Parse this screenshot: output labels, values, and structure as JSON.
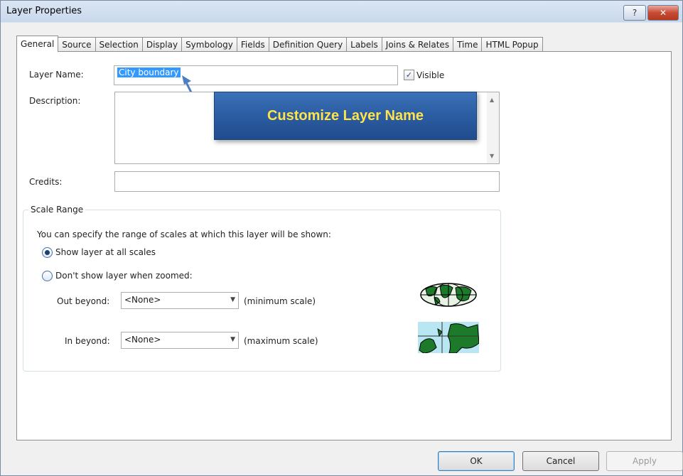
{
  "window": {
    "title": "Layer Properties",
    "help_label": "?",
    "close_label": "✕"
  },
  "tabs": [
    "General",
    "Source",
    "Selection",
    "Display",
    "Symbology",
    "Fields",
    "Definition Query",
    "Labels",
    "Joins & Relates",
    "Time",
    "HTML Popup"
  ],
  "general": {
    "layer_name_label": "Layer Name:",
    "layer_name_value": "City boundary",
    "visible_label": "Visible",
    "visible_checked": true,
    "description_label": "Description:",
    "description_value": "",
    "credits_label": "Credits:",
    "credits_value": ""
  },
  "callout": {
    "text": "Customize Layer Name",
    "text_color": "#ffe34a",
    "bg_color": "#2a5aa0"
  },
  "scale_range": {
    "title": "Scale Range",
    "hint": "You can specify the range of scales at which this layer will be shown:",
    "option_all": "Show layer at all scales",
    "option_zoomed": "Don't show layer when zoomed:",
    "selected_option": "all",
    "out_beyond_label": "Out beyond:",
    "out_beyond_value": "<None>",
    "out_beyond_note": "(minimum scale)",
    "in_beyond_label": "In beyond:",
    "in_beyond_value": "<None>",
    "in_beyond_note": "(maximum scale)",
    "icons": [
      "globe-icon",
      "zoomed-map-icon"
    ]
  },
  "buttons": {
    "ok": "OK",
    "cancel": "Cancel",
    "apply": "Apply"
  }
}
